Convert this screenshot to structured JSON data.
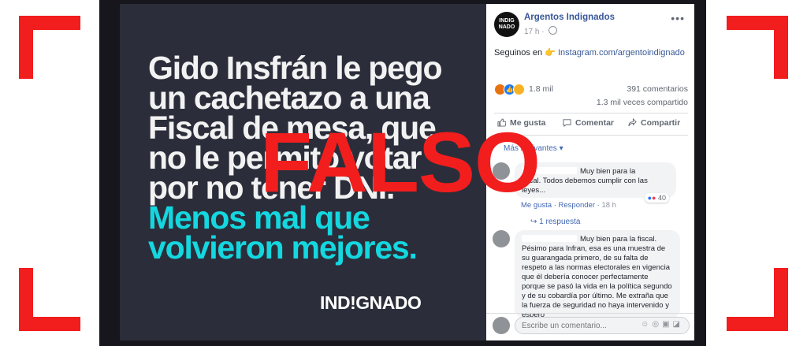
{
  "stamp": {
    "label": "FALSO"
  },
  "image": {
    "headline_lines": [
      "Gido Insfrán le pego",
      "un cachetazo a una",
      "Fiscal de mesa, que",
      "no le permito votar",
      "por no tener DNI."
    ],
    "highlight_lines": [
      "Menos mal que",
      "volvieron mejores."
    ],
    "brand": "IND!GNADO"
  },
  "post": {
    "page_name": "Argentos Indignados",
    "avatar_text": "INDIG NADO",
    "time": "17 h",
    "text_prefix": "Seguinos en",
    "text_link": "Instagram.com/argentoindignado",
    "reaction_count": "1.8 mil",
    "comments_count": "391 comentarios",
    "shares_count": "1.3 mil veces compartido"
  },
  "actions": {
    "like": "Me gusta",
    "comment": "Comentar",
    "share": "Compartir"
  },
  "comments_sort": "Más relevantes",
  "comments": [
    {
      "text_line1": "Muy bien para la",
      "text_line2": "fiscal. Todos debemos cumplir con las",
      "text_line3": "leyes...",
      "like": "Me gusta",
      "reply": "Responder",
      "time": "18 h",
      "reactions": "40",
      "replies": "1 respuesta"
    },
    {
      "text": "Muy bien para la fiscal. Pésimo para Infran, esa es una muestra de su guarangada primero, de su falta de respeto a las normas electorales en vigencia que él debería conocer perfectamente porque se pasó la vida en la política segundo y de su cobardía por último. Me extraña que la fuerza de seguridad no haya intervenido y espero"
    }
  ],
  "composer": {
    "placeholder": "Escribe un comentario..."
  },
  "colors": {
    "stamp_red": "#f21d1d",
    "fb_blue": "#385898",
    "highlight_cyan": "#14d7df",
    "image_bg": "#2b2e3a"
  }
}
